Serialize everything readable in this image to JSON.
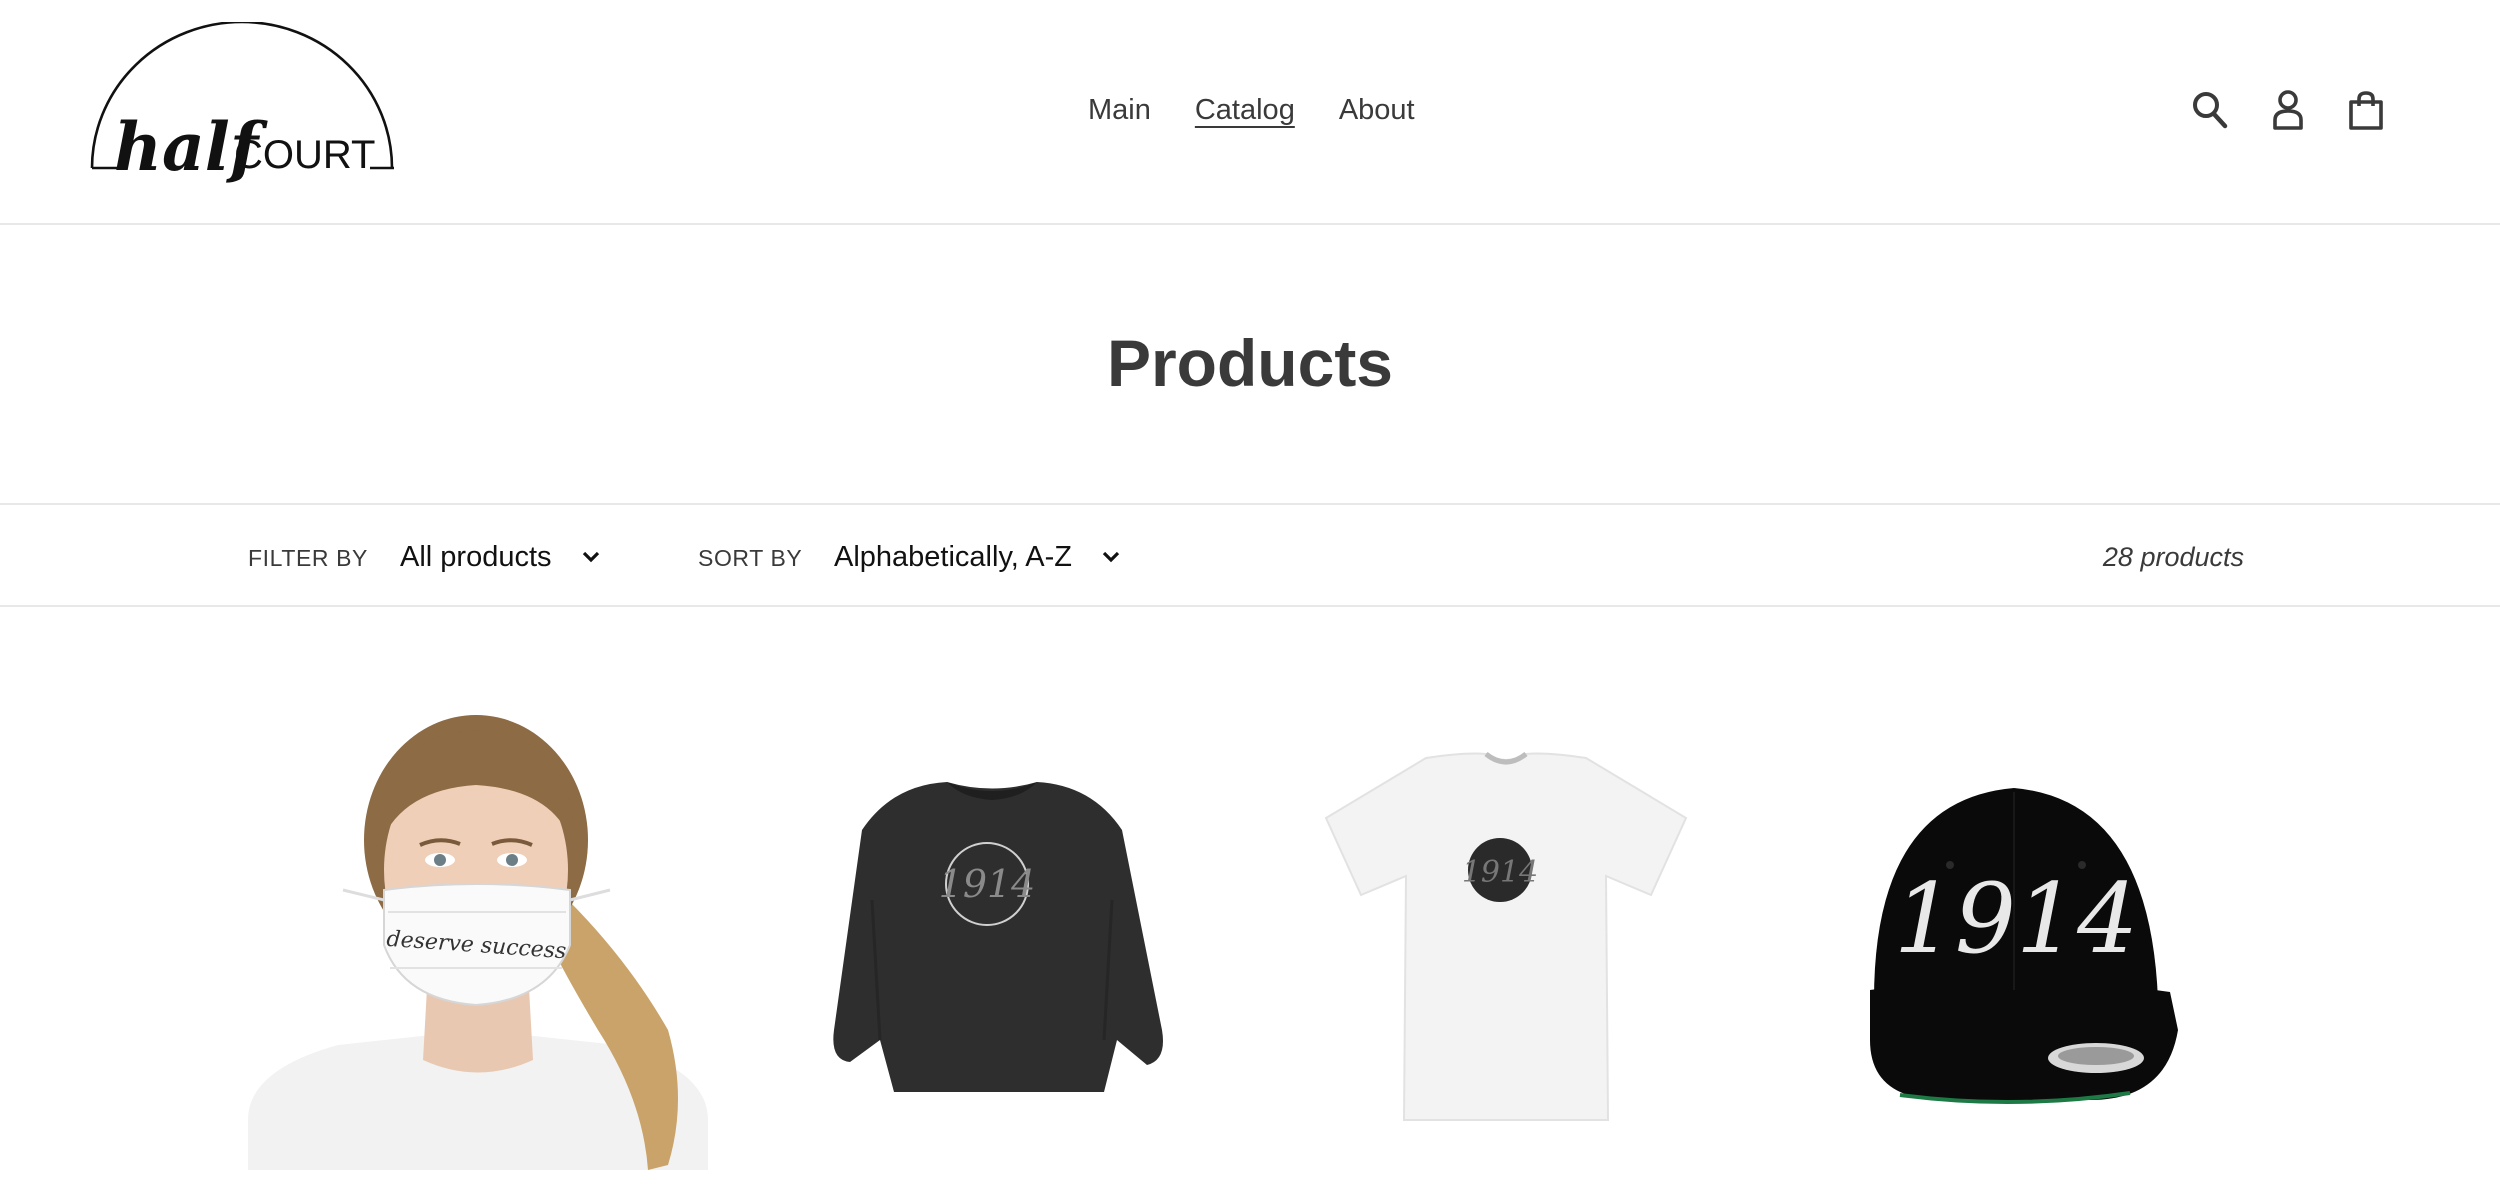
{
  "header": {
    "logo": {
      "text_left": "half",
      "text_right": "COURT"
    },
    "nav": [
      {
        "label": "Main",
        "active": false
      },
      {
        "label": "Catalog",
        "active": true
      },
      {
        "label": "About",
        "active": false
      }
    ],
    "icons": [
      "search-icon",
      "account-icon",
      "cart-icon"
    ]
  },
  "page": {
    "title": "Products"
  },
  "filters": {
    "filter_label": "FILTER BY",
    "filter_value": "All products",
    "sort_label": "SORT BY",
    "sort_value": "Alphabetically, A-Z",
    "count": "28 products"
  },
  "products": [
    {
      "image": "face-mask-photo",
      "mask_text": "deserve success"
    },
    {
      "image": "black-sweatshirt",
      "print_text": "1914"
    },
    {
      "image": "white-tshirt",
      "print_text": "1914"
    },
    {
      "image": "black-snapback-cap",
      "print_text": "1914"
    }
  ],
  "colors": {
    "text": "#3a3a3a",
    "divider": "#e8e8e8",
    "background": "#ffffff"
  }
}
